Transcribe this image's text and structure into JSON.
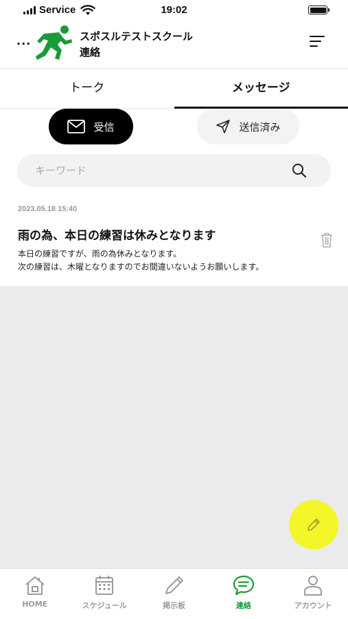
{
  "status_bar": {
    "carrier": "Service",
    "time": "19:02"
  },
  "header": {
    "back_label": "...",
    "school_name": "スポスルテストスクール",
    "page_title": "連絡"
  },
  "tabs": [
    {
      "label": "トーク",
      "active": false
    },
    {
      "label": "メッセージ",
      "active": true
    }
  ],
  "segments": {
    "inbox_label": "受信",
    "sent_label": "送信済み"
  },
  "search": {
    "placeholder": "キーワード"
  },
  "messages": [
    {
      "date": "2023.05.18 15:40",
      "title": "雨の為、本日の練習は休みとなります",
      "body_line1": "本日の練習ですが、雨の為休みとなります。",
      "body_line2": "次の練習は、木曜となりますのでお間違いないようお願いします。"
    }
  ],
  "bottom_nav": [
    {
      "label": "HOME",
      "icon": "home-icon",
      "active": false
    },
    {
      "label": "スケジュール",
      "icon": "calendar-icon",
      "active": false
    },
    {
      "label": "掲示板",
      "icon": "pencil-icon",
      "active": false
    },
    {
      "label": "連絡",
      "icon": "chat-icon",
      "active": true
    },
    {
      "label": "アカウント",
      "icon": "person-icon",
      "active": false
    }
  ],
  "colors": {
    "accent_green": "#1a9a3a",
    "fab_yellow": "#f3f72a",
    "inactive_gray": "#9b9b9b"
  }
}
